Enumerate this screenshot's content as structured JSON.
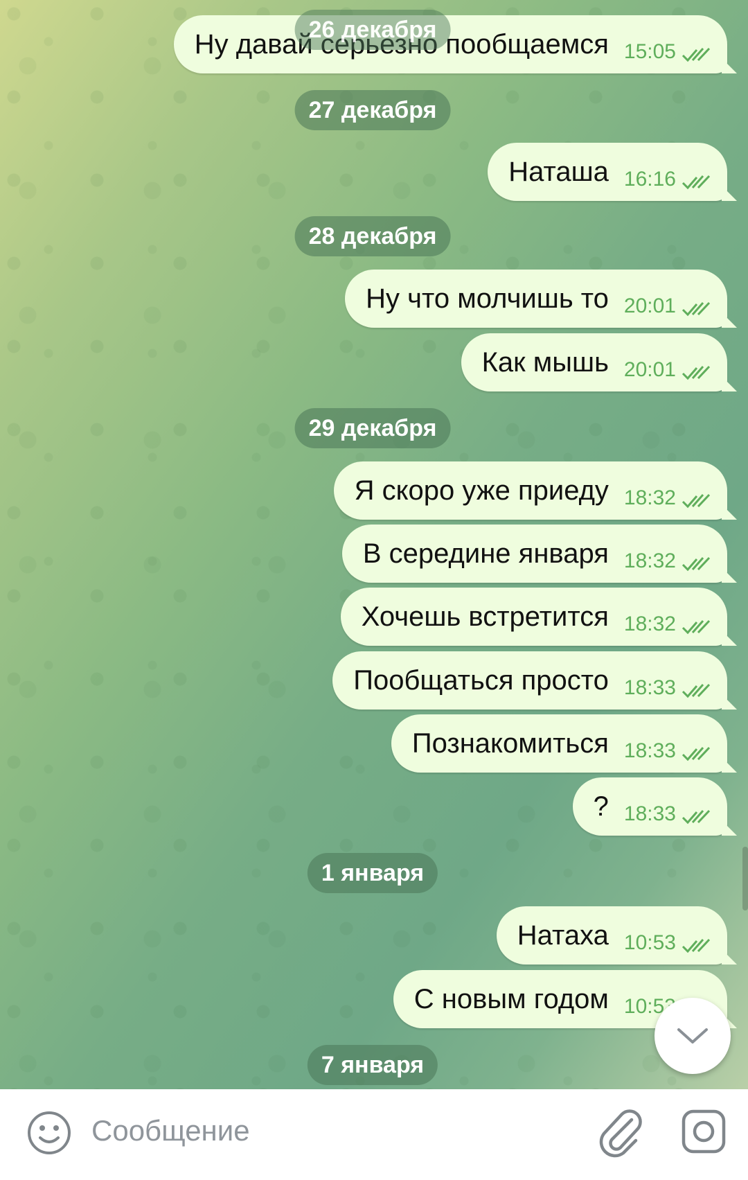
{
  "messages_area": {
    "items": [
      {
        "kind": "date",
        "text": "26 декабря"
      },
      {
        "kind": "msg",
        "text": "Ну давай серьезно пообщаемся",
        "time": "15:05"
      },
      {
        "kind": "date",
        "text": "27 декабря"
      },
      {
        "kind": "msg",
        "text": "Наташа",
        "time": "16:16"
      },
      {
        "kind": "date",
        "text": "28 декабря"
      },
      {
        "kind": "msg",
        "text": "Ну что молчишь то",
        "time": "20:01"
      },
      {
        "kind": "msg",
        "text": "Как мышь",
        "time": "20:01"
      },
      {
        "kind": "date",
        "text": "29 декабря"
      },
      {
        "kind": "msg",
        "text": "Я скоро уже приеду",
        "time": "18:32"
      },
      {
        "kind": "msg",
        "text": "В середине января",
        "time": "18:32"
      },
      {
        "kind": "msg",
        "text": "Хочешь встретится",
        "time": "18:32"
      },
      {
        "kind": "msg",
        "text": "Пообщаться просто",
        "time": "18:33"
      },
      {
        "kind": "msg",
        "text": "Познакомиться",
        "time": "18:33"
      },
      {
        "kind": "msg",
        "text": "?",
        "time": "18:33"
      },
      {
        "kind": "date",
        "text": "1 января"
      },
      {
        "kind": "msg",
        "text": "Натаха",
        "time": "10:53"
      },
      {
        "kind": "msg",
        "text": "С новым годом",
        "time": "10:53"
      },
      {
        "kind": "date",
        "text": "7 января"
      }
    ]
  },
  "input_bar": {
    "placeholder": "Сообщение",
    "emoji_icon": "emoji-smile-icon",
    "attach_icon": "paperclip-icon",
    "camera_icon": "camera-icon"
  },
  "scroll_down_icon": "chevron-down-icon",
  "colors": {
    "outgoing_bubble": "#effdde",
    "time_text": "#5fae5b",
    "date_chip": "#4b7658"
  }
}
